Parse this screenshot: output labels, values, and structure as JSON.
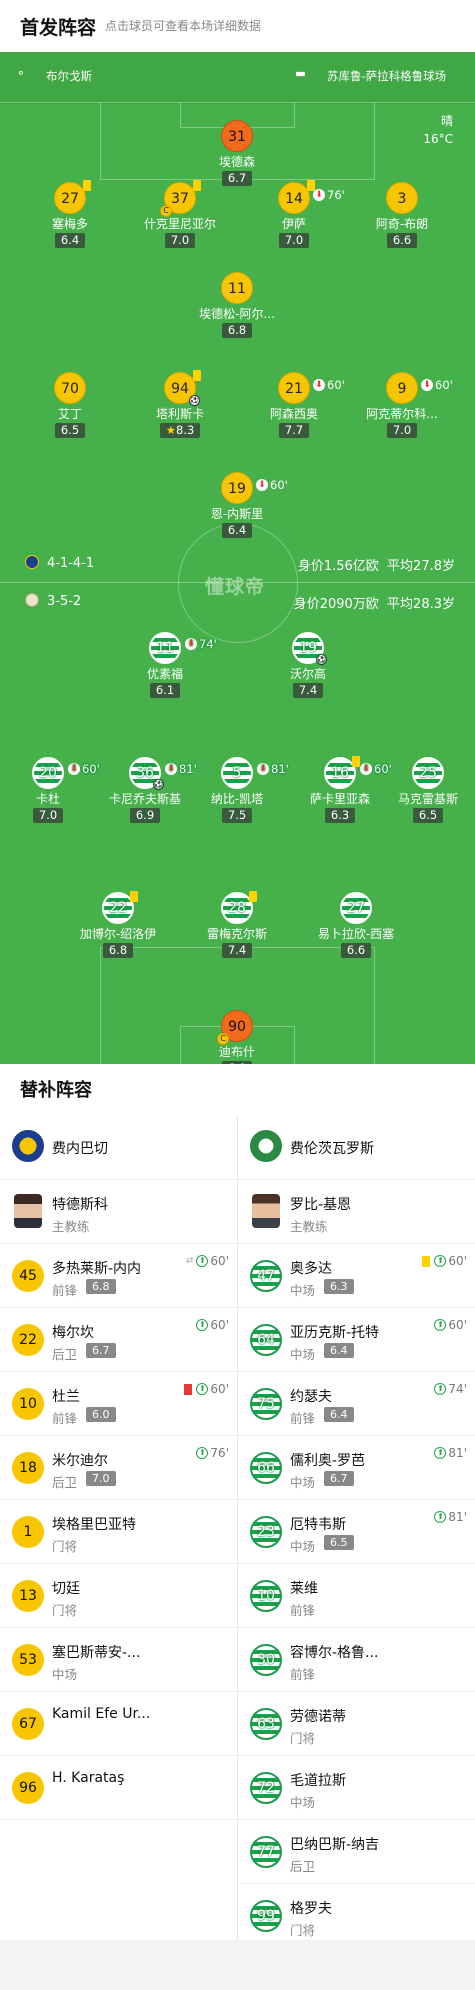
{
  "header": {
    "title": "首发阵容",
    "subtitle": "点击球员可查看本场详细数据"
  },
  "match": {
    "city": "布尔戈斯",
    "venue": "苏库鲁-萨拉科格鲁球场",
    "weather": "晴",
    "temp": "16°C"
  },
  "home": {
    "name": "费内巴切",
    "formation": "4-1-4-1",
    "value": "身价1.56亿欧",
    "age": "平均27.8岁"
  },
  "away": {
    "name": "费伦茨瓦罗斯",
    "formation": "3-5-2",
    "value": "身价2090万欧",
    "age": "平均28.3岁"
  },
  "watermark": "懂球帝",
  "home_players": [
    {
      "num": "31",
      "name": "埃德森",
      "rating": "6.7",
      "color": "o"
    },
    {
      "num": "27",
      "name": "塞梅多",
      "rating": "6.4",
      "color": "y",
      "yellow": true
    },
    {
      "num": "37",
      "name": "什克里尼亚尔",
      "rating": "7.0",
      "color": "y",
      "yellow": true,
      "captain": true
    },
    {
      "num": "14",
      "name": "伊萨",
      "rating": "7.0",
      "color": "y",
      "yellow": true,
      "sub": "76'"
    },
    {
      "num": "3",
      "name": "阿奇-布朗",
      "rating": "6.6",
      "color": "y"
    },
    {
      "num": "11",
      "name": "埃德松-阿尔...",
      "rating": "6.8",
      "color": "y"
    },
    {
      "num": "70",
      "name": "艾丁",
      "rating": "6.5",
      "color": "y"
    },
    {
      "num": "94",
      "name": "塔利斯卡",
      "rating": "8.3",
      "color": "y",
      "yellow": true,
      "goal": true,
      "star": true
    },
    {
      "num": "21",
      "name": "阿森西奥",
      "rating": "7.7",
      "color": "y",
      "sub": "60'"
    },
    {
      "num": "9",
      "name": "阿克蒂尔科...",
      "rating": "7.0",
      "color": "y",
      "sub": "60'"
    },
    {
      "num": "19",
      "name": "恩-内斯里",
      "rating": "6.4",
      "color": "y",
      "sub": "60'"
    }
  ],
  "away_players": [
    {
      "num": "11",
      "name": "优素福",
      "rating": "6.1",
      "color": "g",
      "sub": "74'"
    },
    {
      "num": "19",
      "name": "沃尔高",
      "rating": "7.4",
      "color": "g",
      "goal": true
    },
    {
      "num": "20",
      "name": "卡杜",
      "rating": "7.0",
      "color": "g",
      "sub": "60'"
    },
    {
      "num": "36",
      "name": "卡尼乔夫斯基",
      "rating": "6.9",
      "color": "g",
      "sub": "81'",
      "goal": true
    },
    {
      "num": "5",
      "name": "纳比-凯塔",
      "rating": "7.5",
      "color": "g",
      "sub": "81'"
    },
    {
      "num": "16",
      "name": "萨卡里亚森",
      "rating": "6.3",
      "color": "g",
      "yellow": true,
      "sub": "60'"
    },
    {
      "num": "25",
      "name": "马克雷基斯",
      "rating": "6.5",
      "color": "g"
    },
    {
      "num": "22",
      "name": "加博尔-绍洛伊",
      "rating": "6.8",
      "color": "g",
      "yellow": true
    },
    {
      "num": "28",
      "name": "雷梅克尔斯",
      "rating": "7.4",
      "color": "g",
      "yellow": true
    },
    {
      "num": "27",
      "name": "易卜拉欣-西塞",
      "rating": "6.6",
      "color": "g"
    },
    {
      "num": "90",
      "name": "迪布什",
      "rating": "6.8",
      "color": "o",
      "captain": true
    }
  ],
  "subs": {
    "title": "替补阵容",
    "coach_label": "主教练",
    "home_coach": "特德斯科",
    "away_coach": "罗比-基恩",
    "home": [
      {
        "num": "45",
        "name": "多热莱斯-内内",
        "pos": "前锋",
        "rating": "6.8",
        "ev": "60'",
        "swap": true
      },
      {
        "num": "22",
        "name": "梅尔坎",
        "pos": "后卫",
        "rating": "6.7",
        "ev": "60'"
      },
      {
        "num": "10",
        "name": "杜兰",
        "pos": "前锋",
        "rating": "6.0",
        "ev": "60'",
        "red": true
      },
      {
        "num": "18",
        "name": "米尔迪尔",
        "pos": "后卫",
        "rating": "7.0",
        "ev": "76'"
      },
      {
        "num": "1",
        "name": "埃格里巴亚特",
        "pos": "门将"
      },
      {
        "num": "13",
        "name": "切廷",
        "pos": "门将"
      },
      {
        "num": "53",
        "name": "塞巴斯蒂安-...",
        "pos": "中场"
      },
      {
        "num": "67",
        "name": "Kamil Efe Ür...",
        "pos": ""
      },
      {
        "num": "96",
        "name": "H. Karataş",
        "pos": ""
      }
    ],
    "away": [
      {
        "num": "47",
        "name": "奥多达",
        "pos": "中场",
        "rating": "6.3",
        "ev": "60'",
        "yellow": true
      },
      {
        "num": "64",
        "name": "亚历克斯-托特",
        "pos": "中场",
        "rating": "6.4",
        "ev": "60'"
      },
      {
        "num": "75",
        "name": "约瑟夫",
        "pos": "前锋",
        "rating": "6.4",
        "ev": "74'"
      },
      {
        "num": "66",
        "name": "儒利奥-罗芭",
        "pos": "中场",
        "rating": "6.7",
        "ev": "81'"
      },
      {
        "num": "23",
        "name": "厄特韦斯",
        "pos": "中场",
        "rating": "6.5",
        "ev": "81'"
      },
      {
        "num": "10",
        "name": "莱维",
        "pos": "前锋"
      },
      {
        "num": "30",
        "name": "容博尔-格鲁...",
        "pos": "前锋"
      },
      {
        "num": "63",
        "name": "劳德诺蒂",
        "pos": "门将"
      },
      {
        "num": "72",
        "name": "毛道拉斯",
        "pos": "中场"
      },
      {
        "num": "77",
        "name": "巴纳巴斯-纳吉",
        "pos": "后卫"
      },
      {
        "num": "99",
        "name": "格罗夫",
        "pos": "门将"
      }
    ]
  },
  "colors": {
    "pitch": "#46b04b",
    "home": "#f7c600",
    "keeper": "#f26b1d",
    "away": "#18a04a"
  }
}
